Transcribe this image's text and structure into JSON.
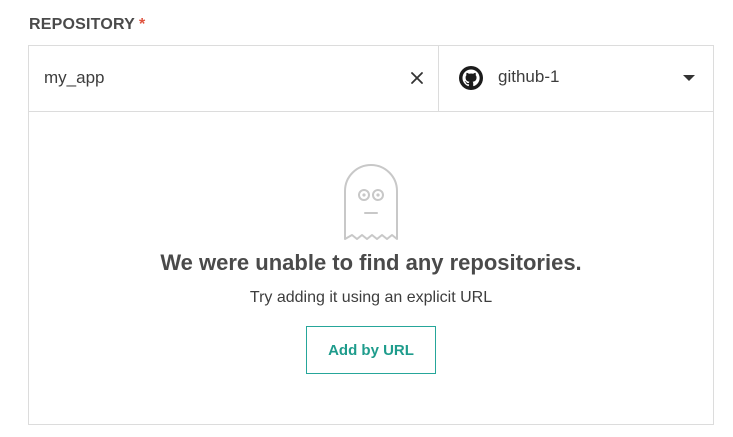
{
  "field": {
    "label": "REPOSITORY",
    "required_mark": "*"
  },
  "search": {
    "value": "my_app",
    "placeholder": ""
  },
  "source": {
    "selected": "github-1",
    "icon": "github-icon"
  },
  "empty_state": {
    "icon": "ghost-icon",
    "title": "We were unable to find any repositories.",
    "subtitle": "Try adding it using an explicit URL",
    "button_label": "Add by URL"
  },
  "colors": {
    "accent": "#26a69a",
    "required": "#e0533f",
    "border": "#dcdcdc"
  }
}
